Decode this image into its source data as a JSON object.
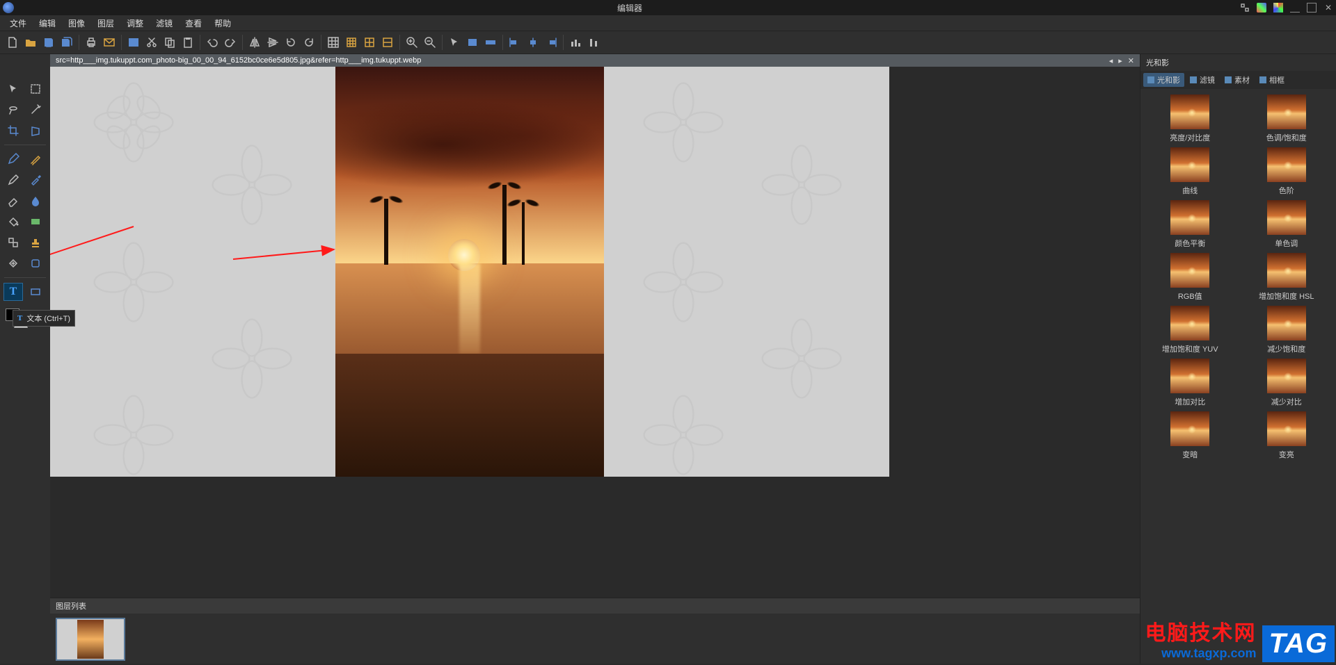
{
  "titlebar": {
    "title": "编辑器"
  },
  "menubar": {
    "items": [
      "文件",
      "编辑",
      "图像",
      "图层",
      "调整",
      "滤镜",
      "查看",
      "帮助"
    ]
  },
  "tabbar": {
    "filename": "src=http___img.tukuppt.com_photo-big_00_00_94_6152bc0ce6e5d805.jpg&refer=http___img.tukuppt.webp"
  },
  "tooltip": {
    "text": "文本 (Ctrl+T)"
  },
  "layers_panel": {
    "title": "图层列表"
  },
  "right_panel": {
    "title": "光和影",
    "tabs": [
      "光和影",
      "滤镜",
      "素材",
      "相框"
    ],
    "effects": [
      "亮度/对比度",
      "色调/饱和度",
      "曲线",
      "色阶",
      "颜色平衡",
      "单色调",
      "RGB值",
      "增加饱和度 HSL",
      "增加饱和度 YUV",
      "减少饱和度",
      "增加对比",
      "减少对比",
      "变暗",
      "变亮"
    ]
  },
  "watermark": {
    "line1": "电脑技术网",
    "line2": "www.tagxp.com",
    "tag": "TAG"
  }
}
